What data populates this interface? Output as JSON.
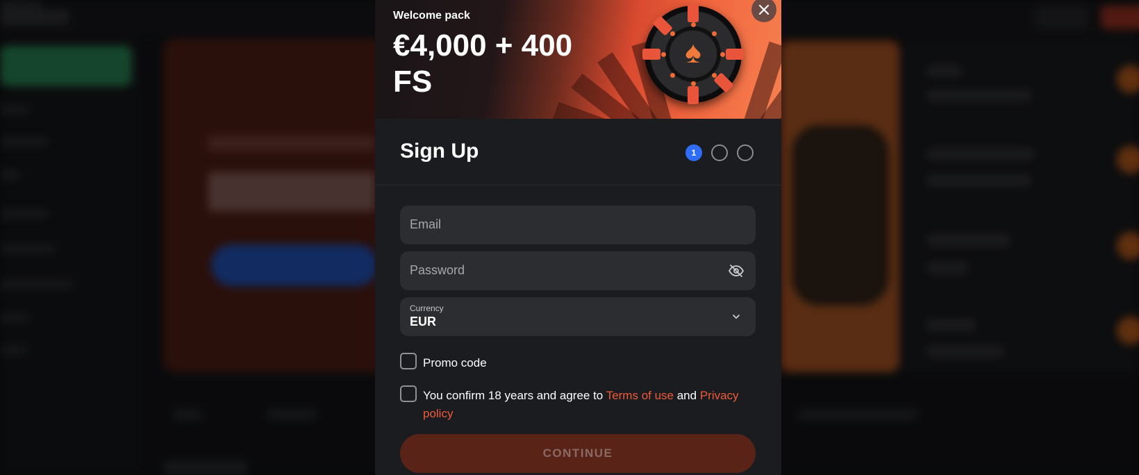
{
  "banner": {
    "subtitle": "Welcome pack",
    "title": "€4,000 + 400 FS",
    "accent_color": "#f26840"
  },
  "modal": {
    "title": "Sign Up",
    "close_icon": "close-icon",
    "steps": [
      "1",
      "",
      ""
    ],
    "active_step": 1
  },
  "form": {
    "email_placeholder": "Email",
    "password_placeholder": "Password",
    "password_icon": "eye-off-icon",
    "currency_label": "Currency",
    "currency_value": "EUR",
    "currency_icon": "chevron-down-icon",
    "promo_label": "Promo code",
    "terms_prefix": "You confirm 18 years and agree to ",
    "terms_link": "Terms of use",
    "terms_mid": " and ",
    "privacy_link": "Privacy policy",
    "continue_label": "CONTINUE"
  },
  "colors": {
    "link": "#f05a3a",
    "step_active": "#2f6df6",
    "continue_bg": "#5a2318"
  }
}
